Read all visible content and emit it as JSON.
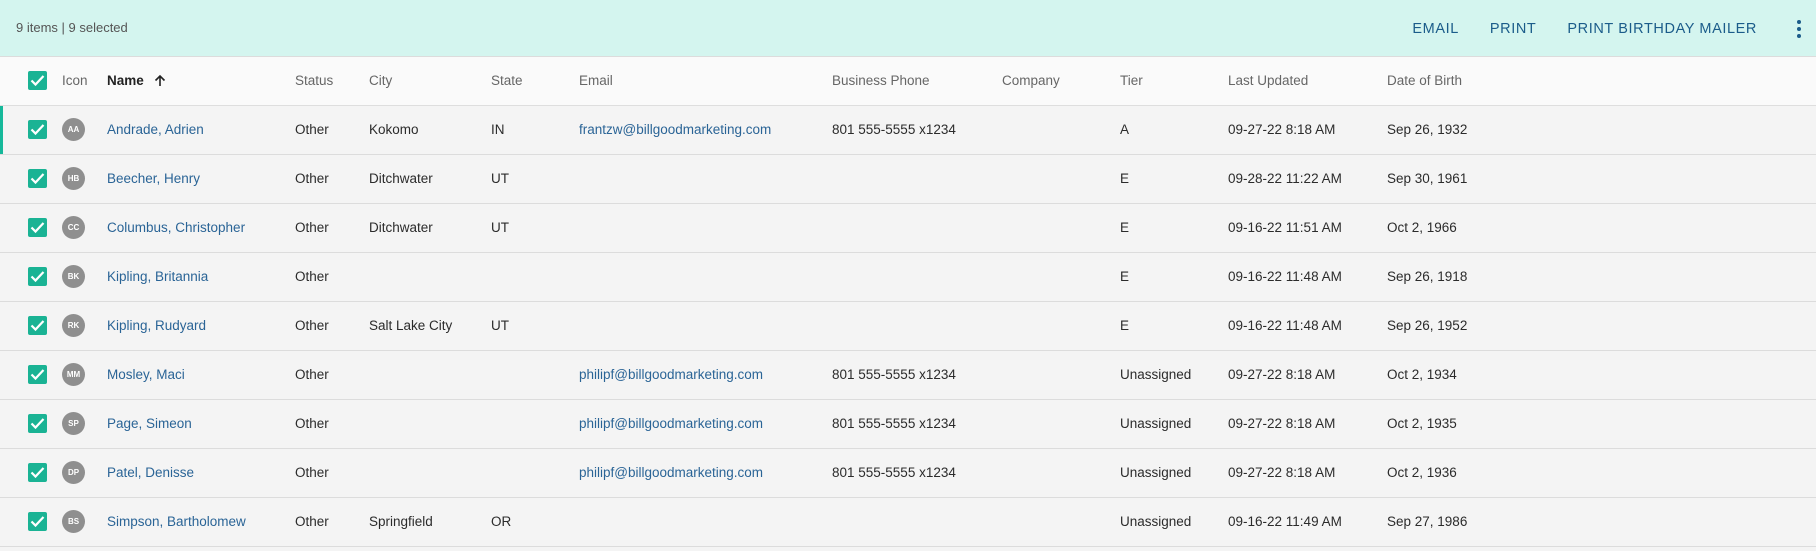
{
  "toolbar": {
    "count_text": "9 items | 9 selected",
    "email_label": "EMAIL",
    "print_label": "PRINT",
    "birthday_label": "PRINT BIRTHDAY MAILER",
    "more_icon": "more-vertical-icon"
  },
  "colors": {
    "accent": "#1ab394",
    "toolbar_bg": "#d4f5ef",
    "link": "#2a6496",
    "avatar": "#8f8f8f"
  },
  "table": {
    "headers": {
      "icon": "Icon",
      "name": "Name",
      "status": "Status",
      "city": "City",
      "state": "State",
      "email": "Email",
      "phone": "Business Phone",
      "company": "Company",
      "tier": "Tier",
      "updated": "Last Updated",
      "dob": "Date of Birth"
    },
    "sort": {
      "column": "Name",
      "direction": "ascending"
    },
    "rows": [
      {
        "initials": "AA",
        "name": "Andrade, Adrien",
        "status": "Other",
        "city": "Kokomo",
        "state": "IN",
        "email": "frantzw@billgoodmarketing.com",
        "phone": "801 555-5555 x1234",
        "company": "",
        "tier": "A",
        "updated": "09-27-22 8:18 AM",
        "dob": "Sep 26, 1932",
        "selected": true
      },
      {
        "initials": "HB",
        "name": "Beecher, Henry",
        "status": "Other",
        "city": "Ditchwater",
        "state": "UT",
        "email": "",
        "phone": "",
        "company": "",
        "tier": "E",
        "updated": "09-28-22 11:22 AM",
        "dob": "Sep 30, 1961",
        "selected": true
      },
      {
        "initials": "CC",
        "name": "Columbus, Christopher",
        "status": "Other",
        "city": "Ditchwater",
        "state": "UT",
        "email": "",
        "phone": "",
        "company": "",
        "tier": "E",
        "updated": "09-16-22 11:51 AM",
        "dob": "Oct 2, 1966",
        "selected": true
      },
      {
        "initials": "BK",
        "name": "Kipling, Britannia",
        "status": "Other",
        "city": "",
        "state": "",
        "email": "",
        "phone": "",
        "company": "",
        "tier": "E",
        "updated": "09-16-22 11:48 AM",
        "dob": "Sep 26, 1918",
        "selected": true
      },
      {
        "initials": "RK",
        "name": "Kipling, Rudyard",
        "status": "Other",
        "city": "Salt Lake City",
        "state": "UT",
        "email": "",
        "phone": "",
        "company": "",
        "tier": "E",
        "updated": "09-16-22 11:48 AM",
        "dob": "Sep 26, 1952",
        "selected": true
      },
      {
        "initials": "MM",
        "name": "Mosley, Maci",
        "status": "Other",
        "city": "",
        "state": "",
        "email": "philipf@billgoodmarketing.com",
        "phone": "801 555-5555 x1234",
        "company": "",
        "tier": "Unassigned",
        "updated": "09-27-22 8:18 AM",
        "dob": "Oct 2, 1934",
        "selected": true
      },
      {
        "initials": "SP",
        "name": "Page, Simeon",
        "status": "Other",
        "city": "",
        "state": "",
        "email": "philipf@billgoodmarketing.com",
        "phone": "801 555-5555 x1234",
        "company": "",
        "tier": "Unassigned",
        "updated": "09-27-22 8:18 AM",
        "dob": "Oct 2, 1935",
        "selected": true
      },
      {
        "initials": "DP",
        "name": "Patel, Denisse",
        "status": "Other",
        "city": "",
        "state": "",
        "email": "philipf@billgoodmarketing.com",
        "phone": "801 555-5555 x1234",
        "company": "",
        "tier": "Unassigned",
        "updated": "09-27-22 8:18 AM",
        "dob": "Oct 2, 1936",
        "selected": true
      },
      {
        "initials": "BS",
        "name": "Simpson, Bartholomew",
        "status": "Other",
        "city": "Springfield",
        "state": "OR",
        "email": "",
        "phone": "",
        "company": "",
        "tier": "Unassigned",
        "updated": "09-16-22 11:49 AM",
        "dob": "Sep 27, 1986",
        "selected": true
      }
    ]
  }
}
